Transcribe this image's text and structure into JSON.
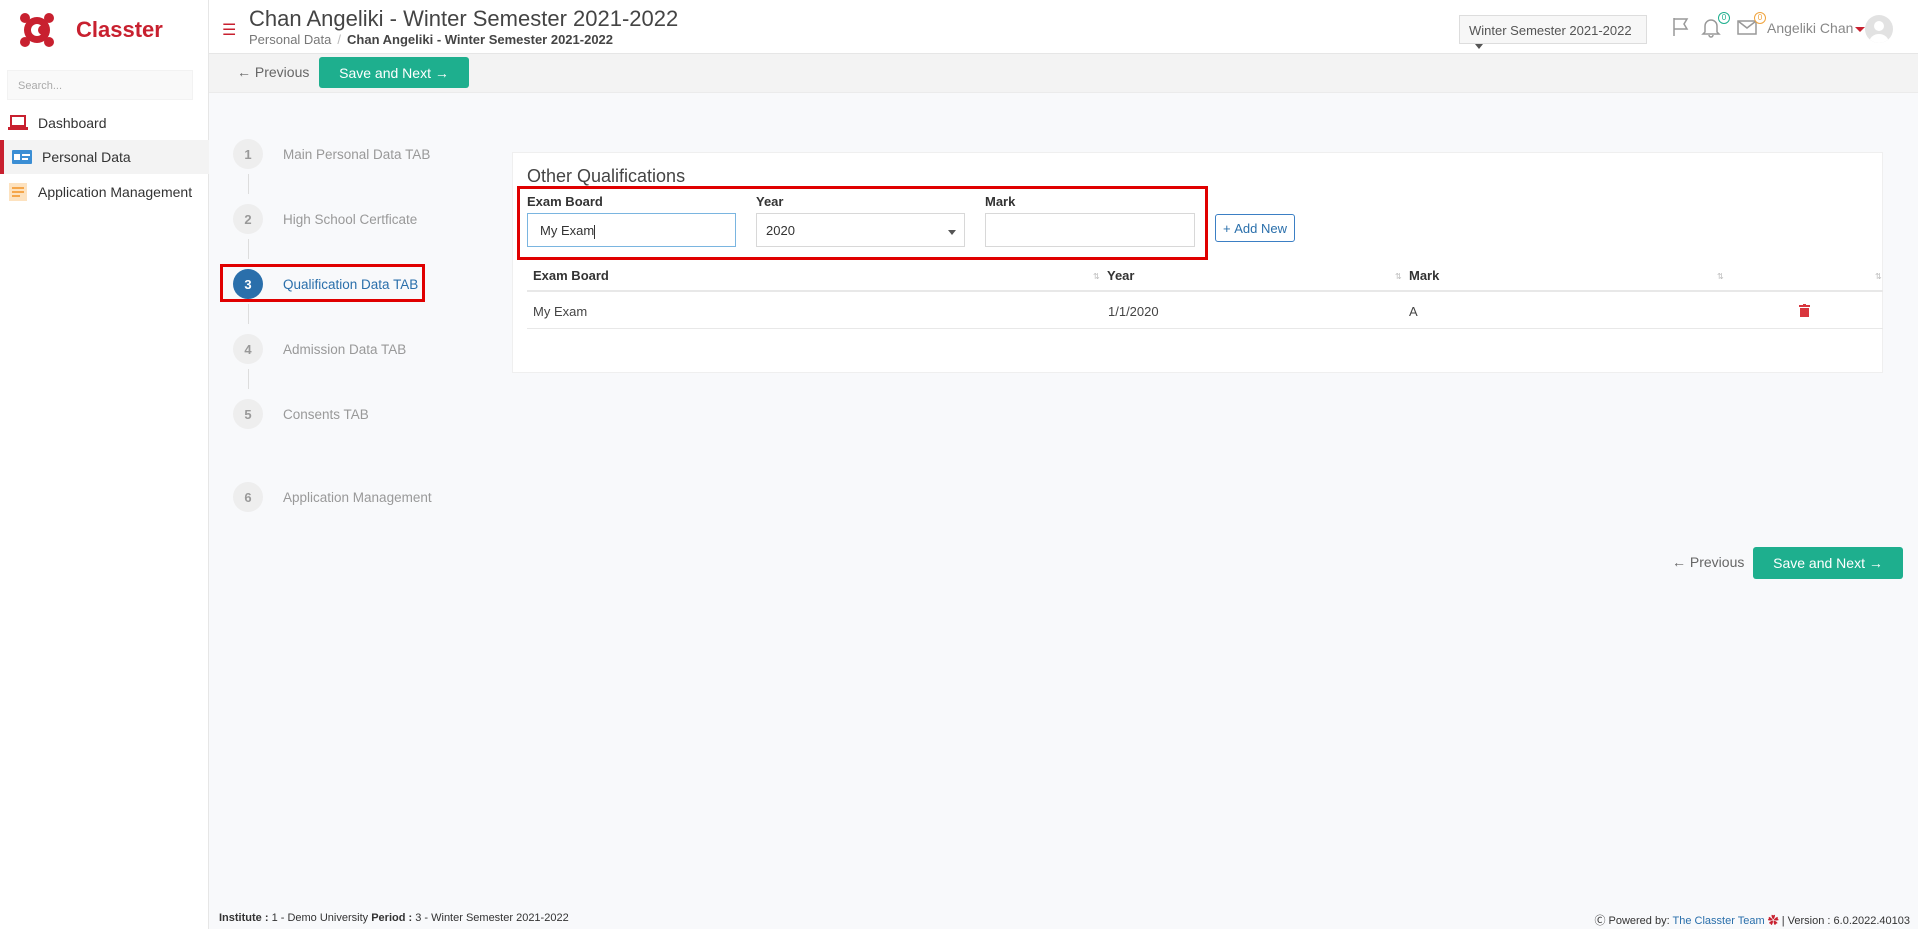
{
  "app": {
    "name": "Classter",
    "brand_color": "#c8202f",
    "accent_color": "#1eaf8e"
  },
  "sidebar": {
    "search_placeholder": "Search...",
    "items": [
      {
        "label": "Dashboard",
        "icon": "laptop-icon"
      },
      {
        "label": "Personal Data",
        "icon": "id-card-icon",
        "active": true
      },
      {
        "label": "Application Management",
        "icon": "form-icon"
      }
    ]
  },
  "header": {
    "title": "Chan Angeliki - Winter Semester 2021-2022",
    "breadcrumb": [
      "Personal Data",
      "Chan Angeliki - Winter Semester 2021-2022"
    ],
    "semester": "Winter Semester 2021-2022",
    "notifications_count": "0",
    "messages_count": "0",
    "user_name": "Angeliki Chan"
  },
  "toolbar": {
    "previous_label": "Previous",
    "save_next_label": "Save and Next"
  },
  "steps": [
    {
      "num": "1",
      "label": "Main Personal Data TAB"
    },
    {
      "num": "2",
      "label": "High School Certficate"
    },
    {
      "num": "3",
      "label": "Qualification Data TAB",
      "active": true
    },
    {
      "num": "4",
      "label": "Admission Data TAB"
    },
    {
      "num": "5",
      "label": "Consents TAB"
    },
    {
      "num": "6",
      "label": "Application Management"
    }
  ],
  "qualifications": {
    "title": "Other Qualifications",
    "fields": {
      "exam_board": {
        "label": "Exam Board",
        "value": "My Exam"
      },
      "year": {
        "label": "Year",
        "value": "2020"
      },
      "mark": {
        "label": "Mark",
        "value": ""
      }
    },
    "add_new_label": "Add New",
    "columns": [
      "Exam Board",
      "Year",
      "Mark"
    ],
    "rows": [
      {
        "exam_board": "My Exam",
        "year": "1/1/2020",
        "mark": "A"
      }
    ]
  },
  "bottom_nav": {
    "previous_label": "Previous",
    "save_next_label": "Save and Next"
  },
  "footer": {
    "institute_label": "Institute :",
    "institute_value": "1 - Demo University",
    "period_label": "Period :",
    "period_value": "3 - Winter Semester 2021-2022",
    "powered_by": "Powered by:",
    "team": "The Classter Team",
    "version": "| Version : 6.0.2022.40103"
  }
}
